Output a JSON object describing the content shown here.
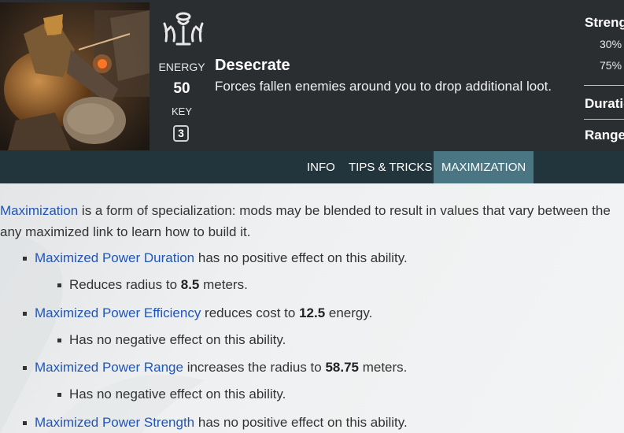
{
  "header": {
    "energy_label": "ENERGY",
    "energy_value": "50",
    "key_label": "KEY",
    "key_value": "3",
    "ability_name": "Desecrate",
    "ability_description": "Forces fallen enemies around you to drop additional loot."
  },
  "stats": {
    "strength_title": "Streng",
    "strength_values": [
      "30%",
      "75%"
    ],
    "duration_title": "Duratio",
    "range_title": "Range"
  },
  "tabs": {
    "info": "INFO",
    "tips": "TIPS & TRICKS",
    "maximization": "MAXIMIZATION",
    "active": "MAXIMIZATION"
  },
  "content": {
    "intro_link": "Maximization",
    "intro_line1_rest": " is a form of specialization: mods may be blended to result in values that vary between the",
    "intro_line2": "any maximized link to learn how to build it.",
    "items": [
      {
        "link": "Maximized Power Duration",
        "text_before": " has no positive effect on this ability.",
        "bold": "",
        "text_after": "",
        "sub_before": "Reduces radius to ",
        "sub_bold": "8.5",
        "sub_after": " meters."
      },
      {
        "link": "Maximized Power Efficiency",
        "text_before": " reduces cost to ",
        "bold": "12.5",
        "text_after": " energy.",
        "sub_before": "Has no negative effect on this ability.",
        "sub_bold": "",
        "sub_after": ""
      },
      {
        "link": "Maximized Power Range",
        "text_before": " increases the radius to ",
        "bold": "58.75",
        "text_after": " meters.",
        "sub_before": "Has no negative effect on this ability.",
        "sub_bold": "",
        "sub_after": ""
      },
      {
        "link": "Maximized Power Strength",
        "text_before": " has no positive effect on this ability.",
        "bold": "",
        "text_after": ""
      }
    ]
  },
  "colors": {
    "header_bg": "#2b2e31",
    "tabbar_bg": "#22353d",
    "active_tab_bg": "#4a7582",
    "link": "#1f56b8"
  }
}
